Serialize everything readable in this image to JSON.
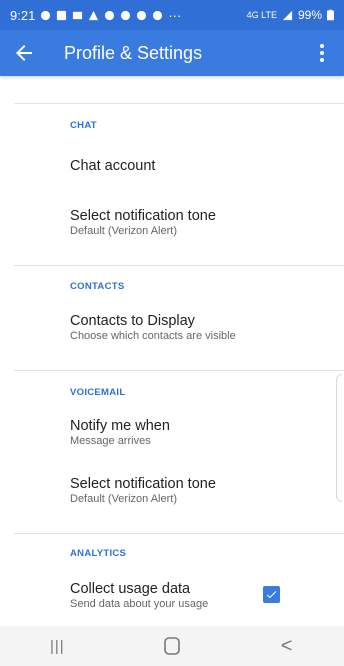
{
  "status_bar": {
    "time": "9:21",
    "ellipsis": "···",
    "network": "4G LTE",
    "battery": "99%"
  },
  "app_bar": {
    "title": "Profile & Settings",
    "back_icon": "arrow-left-icon",
    "more_icon": "more-vert-icon"
  },
  "sections": {
    "chat": {
      "header": "CHAT",
      "items": [
        {
          "title": "Chat account",
          "subtitle": ""
        },
        {
          "title": "Select notification tone",
          "subtitle": "Default (Verizon Alert)"
        }
      ]
    },
    "contacts": {
      "header": "CONTACTS",
      "items": [
        {
          "title": "Contacts to Display",
          "subtitle": "Choose which contacts are visible"
        }
      ]
    },
    "voicemail": {
      "header": "VOICEMAIL",
      "items": [
        {
          "title": "Notify me when",
          "subtitle": "Message arrives"
        },
        {
          "title": "Select notification tone",
          "subtitle": "Default (Verizon Alert)"
        }
      ]
    },
    "analytics": {
      "header": "ANALYTICS",
      "items": [
        {
          "title": "Collect usage data",
          "subtitle": "Send data about your usage",
          "checked": true
        }
      ]
    }
  },
  "colors": {
    "accent": "#3a7be0",
    "status_bar": "#2f6fd6",
    "section_header": "#2f6fd6"
  },
  "nav_bar": {
    "recents": "|||",
    "back": "<"
  }
}
